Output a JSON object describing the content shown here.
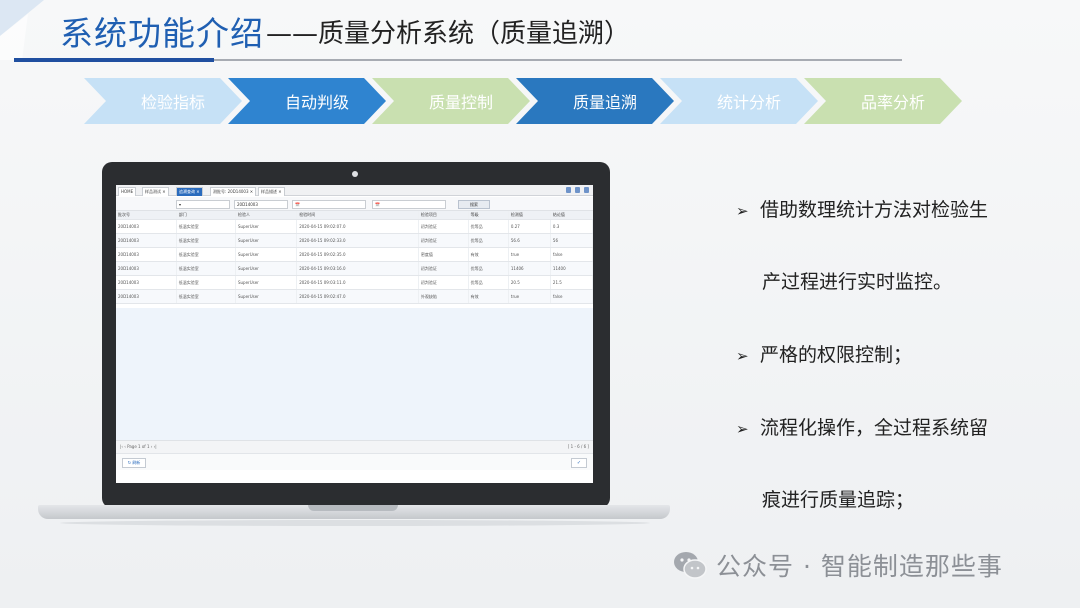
{
  "header": {
    "title_main": "系统功能介绍",
    "title_sub": "——质量分析系统（质量追溯）"
  },
  "steps": [
    {
      "label": "检验指标",
      "color": "#c6e1f6",
      "text_color": "#ffffff"
    },
    {
      "label": "自动判级",
      "color": "#2f84d0",
      "text_color": "#ffffff"
    },
    {
      "label": "质量控制",
      "color": "#c9e0b0",
      "text_color": "#ffffff"
    },
    {
      "label": "质量追溯",
      "color": "#2a78bf",
      "text_color": "#ffffff"
    },
    {
      "label": "统计分析",
      "color": "#c6e1f6",
      "text_color": "#ffffff"
    },
    {
      "label": "品率分析",
      "color": "#c9e0b0",
      "text_color": "#ffffff"
    }
  ],
  "screen": {
    "tabs": [
      {
        "label": "HOME"
      },
      {
        "label": "样品测试 ✕"
      },
      {
        "label": "追溯查询 ✕",
        "active": true
      },
      {
        "label": "测批号: 20D14003 ✕"
      },
      {
        "label": "样品描述 ✕"
      }
    ],
    "filter": {
      "batch_value": "20D14003",
      "search_label": "搜索"
    },
    "columns": [
      "批次号",
      "部门",
      "检验人",
      "检验时间",
      "检验项目",
      "等级",
      "检测值",
      "结论值"
    ],
    "rows": [
      [
        "20D14003",
        "低温实验室",
        "SuperUser",
        "2020-04-15 09:02:07.0",
        "初判验证",
        "优等品",
        "0.27",
        "0.3"
      ],
      [
        "20D14003",
        "低温实验室",
        "SuperUser",
        "2020-04-15 09:02:33.0",
        "初判验证",
        "优等品",
        "56.6",
        "56"
      ],
      [
        "20D14003",
        "低温实验室",
        "SuperUser",
        "2020-04-15 09:02:35.0",
        "密度值",
        "有效",
        "true",
        "false"
      ],
      [
        "20D14003",
        "低温实验室",
        "SuperUser",
        "2020-04-15 09:03:16.0",
        "初判验证",
        "优等品",
        "11406",
        "11400"
      ],
      [
        "20D14003",
        "低温实验室",
        "SuperUser",
        "2020-04-15 09:03:11.0",
        "初判验证",
        "优等品",
        "20.5",
        "21.5"
      ],
      [
        "20D14003",
        "低温实验室",
        "SuperUser",
        "2020-04-15 09:02:47.0",
        "外观缺陷",
        "有效",
        "true",
        "false"
      ]
    ],
    "pager": {
      "left": "|‹  ‹  Page  1  of 1  ›  ›|",
      "right": "[ 1 - 6 / 6 ]"
    },
    "footer": {
      "refresh_label": "刷新",
      "ok_label": "✓"
    }
  },
  "bullets": [
    {
      "line1": "借助数理统计方法对检验生",
      "line2": "产过程进行实时监控。"
    },
    {
      "line1": "严格的权限控制；"
    },
    {
      "line1": "流程化操作，全过程系统留",
      "line2": "痕进行质量追踪；"
    }
  ],
  "watermark": {
    "text": "公众号 · 智能制造那些事"
  }
}
